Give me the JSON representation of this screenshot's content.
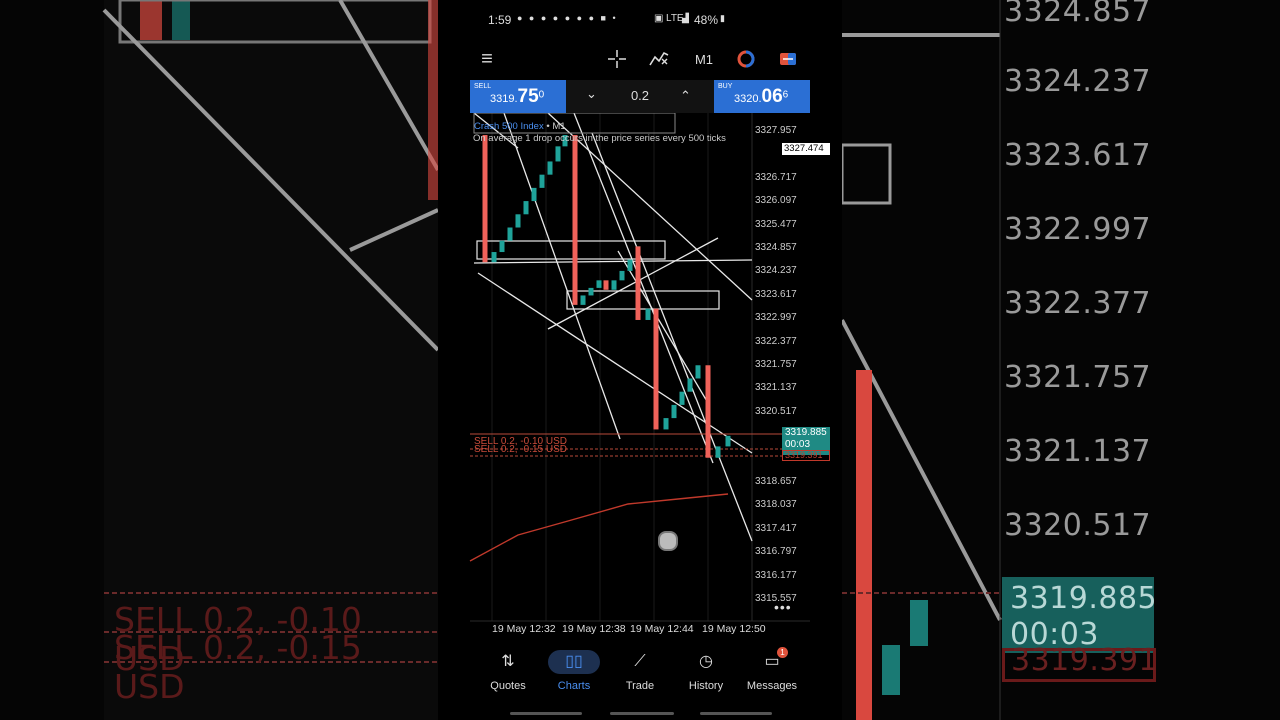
{
  "status_bar": {
    "time": "1:59",
    "network": "LTE",
    "battery": "48%"
  },
  "toolbar": {
    "menu_icon": "menu-icon",
    "timeframe": "M1"
  },
  "trade_bar": {
    "sell_label": "SELL",
    "sell_price_main": "3319.",
    "sell_price_big": "75",
    "sell_price_sup": "0",
    "lot": "0.2",
    "buy_label": "BUY",
    "buy_price_main": "3320.",
    "buy_price_big": "06",
    "buy_price_sup": "6"
  },
  "chart": {
    "symbol": "Crash 500 Index",
    "timeframe": "M1",
    "description": "On average 1 drop occurs in the price series every 500 ticks",
    "y_ticks": [
      "3327.957",
      "3326.717",
      "3326.097",
      "3325.477",
      "3324.857",
      "3324.237",
      "3323.617",
      "3322.997",
      "3322.377",
      "3321.757",
      "3321.137",
      "3320.517",
      "3318.657",
      "3318.037",
      "3317.417",
      "3316.797",
      "3316.177",
      "3315.557"
    ],
    "x_ticks": [
      "19 May 12:32",
      "19 May 12:38",
      "19 May 12:44",
      "19 May 12:50"
    ],
    "high_marker": "3327.474",
    "current_price": "3319.885",
    "countdown": "00:03",
    "bid_marker": "3319.391",
    "orders": [
      "SELL 0.2, -0.10 USD",
      "SELL 0.2, -0.15 USD"
    ],
    "colors": {
      "bull": "#1fa39a",
      "bear": "#f0625a",
      "ma": "#c0392b",
      "accent": "#2b6fd4"
    }
  },
  "background": {
    "prices": [
      "3324.857",
      "3324.237",
      "3323.617",
      "3322.997",
      "3322.377",
      "3321.757",
      "3321.137",
      "3320.517"
    ],
    "current": "3319.885",
    "countdown": "00:03",
    "bid": "3319.391",
    "orders": [
      "SELL 0.2, -0.10 USD",
      "SELL 0.2, -0.15 USD"
    ]
  },
  "nav": {
    "quotes": "Quotes",
    "charts": "Charts",
    "trade": "Trade",
    "history": "History",
    "messages": "Messages",
    "messages_badge": "1"
  }
}
